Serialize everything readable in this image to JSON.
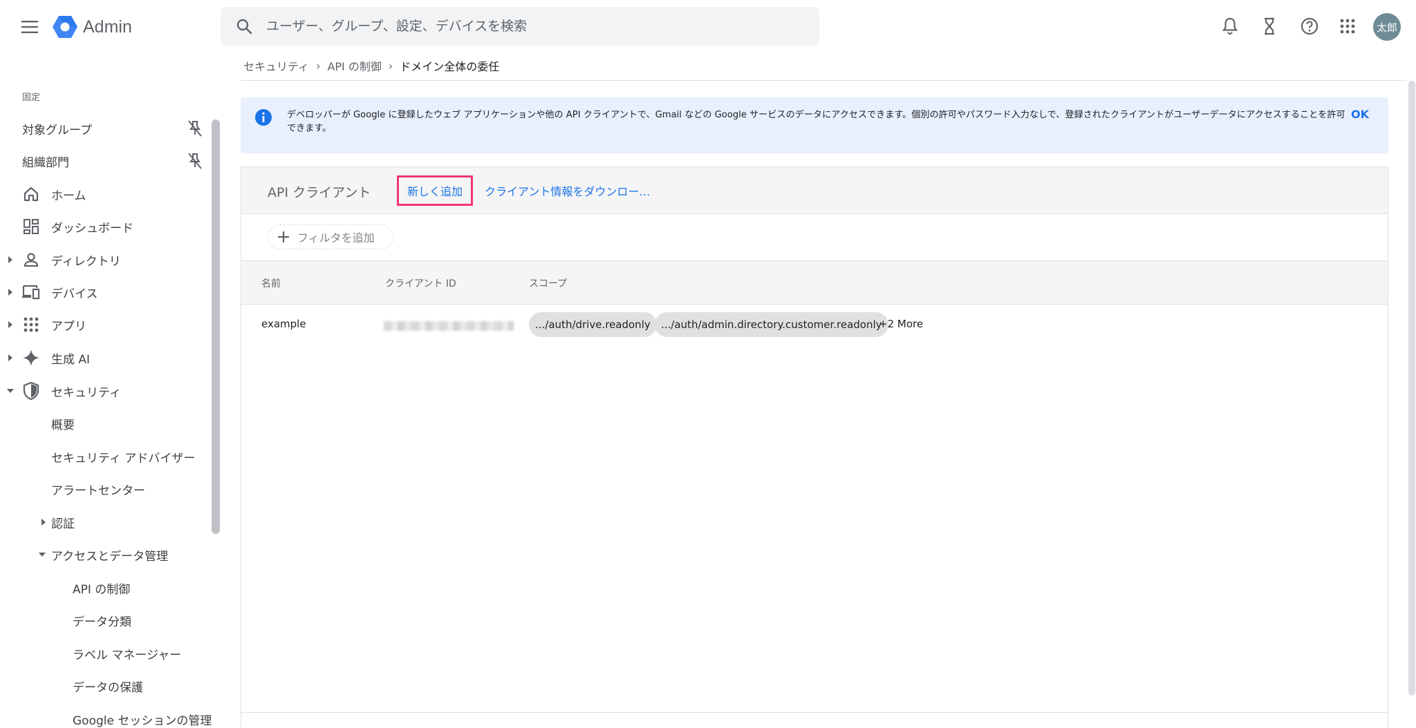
{
  "header": {
    "logo_text": "Admin",
    "search_placeholder": "ユーザー、グループ、設定、デバイスを検索",
    "avatar_text": "太郎"
  },
  "sidebar": {
    "section_label": "固定",
    "pinned": [
      {
        "label": "対象グループ"
      },
      {
        "label": "組織部門"
      }
    ],
    "items": [
      {
        "label": "ホーム",
        "icon": "home-icon"
      },
      {
        "label": "ダッシュボード",
        "icon": "dashboard-icon"
      },
      {
        "label": "ディレクトリ",
        "icon": "person-icon"
      },
      {
        "label": "デバイス",
        "icon": "devices-icon"
      },
      {
        "label": "アプリ",
        "icon": "apps-grid-icon"
      },
      {
        "label": "生成 AI",
        "icon": "sparkle-icon"
      },
      {
        "label": "セキュリティ",
        "icon": "shield-icon"
      }
    ],
    "security_children": [
      {
        "label": "概要"
      },
      {
        "label": "セキュリティ アドバイザー"
      },
      {
        "label": "アラートセンター"
      },
      {
        "label": "認証"
      },
      {
        "label": "アクセスとデータ管理"
      }
    ],
    "access_children": [
      {
        "label": "API の制御"
      },
      {
        "label": "データ分類"
      },
      {
        "label": "ラベル マネージャー"
      },
      {
        "label": "データの保護"
      },
      {
        "label": "Google セッションの管理"
      }
    ]
  },
  "breadcrumb": {
    "items": [
      "セキュリティ",
      "API の制御"
    ],
    "current": "ドメイン全体の委任"
  },
  "banner": {
    "text": "デベロッパーが Google に登録したウェブ アプリケーションや他の API クライアントで、Gmail などの Google サービスのデータにアクセスできます。個別の許可やパスワード入力なしで、登録されたクライアントがユーザーデータにアクセスすることを許可できます。",
    "ok": "OK"
  },
  "panel": {
    "title": "API クライアント",
    "add_new": "新しく追加",
    "download": "クライアント情報をダウンロー…",
    "filter": "フィルタを追加",
    "columns": [
      "名前",
      "クライアント ID",
      "スコープ"
    ],
    "rows": [
      {
        "name": "example",
        "scopes": [
          ".../auth/drive.readonly",
          ".../auth/admin.directory.customer.readonly"
        ],
        "more": "+2 More"
      }
    ]
  },
  "colors": {
    "accent": "#1a73e8",
    "highlight": "#f0357a",
    "banner_bg": "#e8f0fe"
  }
}
